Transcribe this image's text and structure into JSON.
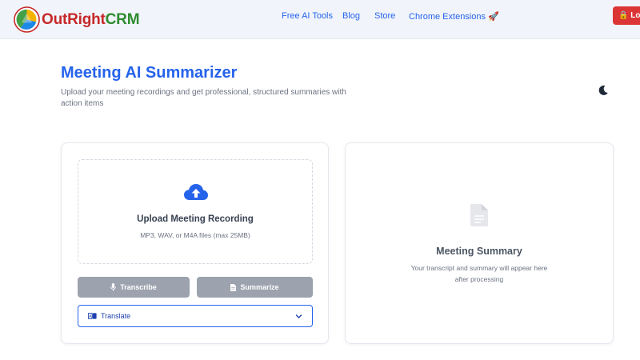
{
  "navbar": {
    "brand_part1": "OutRight",
    "brand_part2": "CRM",
    "links": [
      {
        "label": "Free AI Tools"
      },
      {
        "label": "Blog"
      },
      {
        "label": "Store"
      },
      {
        "label": "Chrome Extensions 🚀"
      }
    ],
    "logout_label": "Log"
  },
  "header": {
    "title": "Meeting AI Summarizer",
    "subtitle": "Upload your meeting recordings and get professional, structured summaries with action items",
    "theme_icon": "moon-icon"
  },
  "upload": {
    "title": "Upload Meeting Recording",
    "hint": "MP3, WAV, or M4A files (max 25MB)",
    "icon": "cloud-upload-icon"
  },
  "actions": {
    "transcribe_label": "Transcribe",
    "summarize_label": "Summarize",
    "translate_label": "Translate"
  },
  "summary": {
    "title": "Meeting Summary",
    "text_line1": "Your transcript and summary will appear here",
    "text_line2": "after processing",
    "icon": "document-icon"
  },
  "colors": {
    "accent": "#2563eb",
    "button_disabled": "#9ca3af",
    "logout": "#dc3535"
  }
}
